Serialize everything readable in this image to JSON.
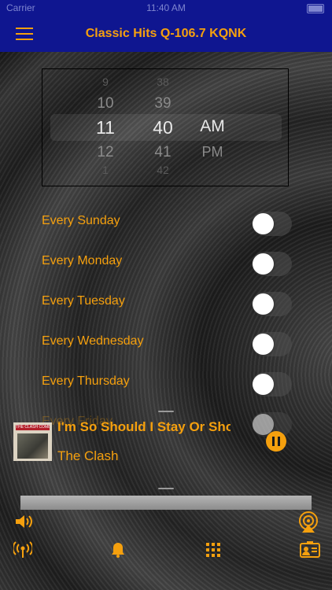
{
  "status_bar": {
    "carrier": "Carrier",
    "time": "11:40 AM"
  },
  "nav": {
    "title": "Classic Hits Q-106.7 KQNK",
    "menu_icon": "hamburger-menu-icon"
  },
  "time_picker": {
    "hours": [
      "9",
      "10",
      "11",
      "12",
      "1"
    ],
    "minutes": [
      "38",
      "39",
      "40",
      "41",
      "42"
    ],
    "periods": [
      "AM",
      "PM"
    ],
    "selected": {
      "hour": "11",
      "minute": "40",
      "period": "AM"
    }
  },
  "days": [
    {
      "label": "Every Sunday",
      "on": false
    },
    {
      "label": "Every Monday",
      "on": false
    },
    {
      "label": "Every Tuesday",
      "on": false
    },
    {
      "label": "Every Wednesday",
      "on": false
    },
    {
      "label": "Every Thursday",
      "on": false
    },
    {
      "label": "Every Friday",
      "on": false
    }
  ],
  "player": {
    "title": "I'm So Should I Stay Or Should I Go",
    "artist": "The Clash",
    "album_art_text": "THE CLASH COMBAT ROCK",
    "state": "playing"
  },
  "volume": {
    "level": 1.0
  },
  "colors": {
    "accent": "#f5a00e",
    "nav_bg": "#0f1690"
  },
  "toolbar": {
    "icons": [
      "volume-icon",
      "airplay-icon",
      "radio-broadcast-icon",
      "alarm-bell-icon",
      "grid-keypad-icon",
      "contact-card-icon"
    ]
  }
}
